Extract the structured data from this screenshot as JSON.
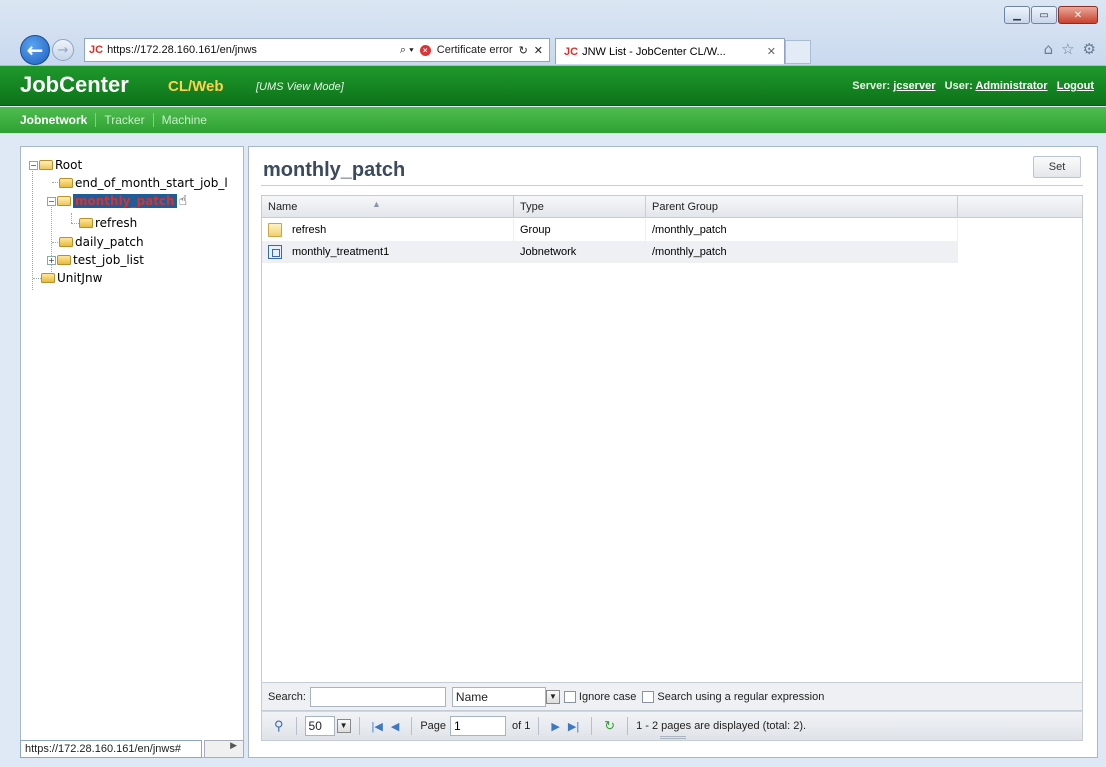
{
  "browser": {
    "url": "https://172.28.160.161/en/jnws",
    "favicon_text": "JC",
    "search_glyph": "⌕ ▾",
    "cert_error": "Certificate error",
    "refresh_glyph": "↻",
    "stop_glyph": "✕",
    "tab_title": "JNW List - JobCenter CL/W...",
    "tab_close": "✕",
    "status_url": "https://172.28.160.161/en/jnws#",
    "window_controls": [
      "▁",
      "▭",
      "✕"
    ],
    "toolbar_icons": [
      "⌂",
      "☆",
      "⚙"
    ]
  },
  "app": {
    "brand": "JobCenter",
    "brand_sub": "CL/Web",
    "mode": "[UMS View Mode]",
    "server_label": "Server:",
    "server": "jcserver",
    "user_label": "User:",
    "user": "Administrator",
    "logout": "Logout"
  },
  "menu": [
    "Jobnetwork",
    "Tracker",
    "Machine"
  ],
  "tree": {
    "root": "Root",
    "items": [
      "end_of_month_start_job_l",
      "monthly_patch",
      "refresh",
      "daily_patch",
      "test_job_list",
      "UnitJnw"
    ]
  },
  "main": {
    "title": "monthly_patch",
    "set_label": "Set",
    "columns": [
      "Name",
      "Type",
      "Parent Group"
    ],
    "rows": [
      {
        "name": "refresh",
        "type": "Group",
        "parent": "/monthly_patch",
        "icon": "folder-icon"
      },
      {
        "name": "monthly_treatment1",
        "type": "Jobnetwork",
        "parent": "/monthly_patch",
        "icon": "jobnetwork-icon"
      }
    ]
  },
  "search": {
    "label": "Search:",
    "value": "",
    "field": "Name",
    "ignore_case": "Ignore case",
    "regex": "Search using a regular expression"
  },
  "pager": {
    "per_page": "50",
    "page_label": "Page",
    "page": "1",
    "of": "of 1",
    "display_msg": "1 - 2 pages are displayed (total: 2)."
  }
}
